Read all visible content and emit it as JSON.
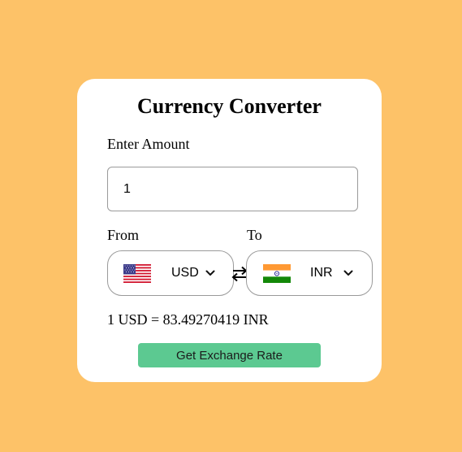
{
  "app": {
    "title": "Currency Converter",
    "amount_label": "Enter Amount",
    "amount_value": "1",
    "from_label": "From",
    "to_label": "To",
    "from_currency": "USD",
    "to_currency": "INR",
    "result_text": "1 USD = 83.49270419 INR",
    "button_label": "Get Exchange Rate"
  },
  "icons": {
    "from_flag": "us-flag-icon",
    "to_flag": "india-flag-icon",
    "swap": "swap-arrows-icon",
    "dropdown": "chevron-down-icon"
  },
  "colors": {
    "background": "#fdc268",
    "card": "#ffffff",
    "button": "#5cc991"
  }
}
